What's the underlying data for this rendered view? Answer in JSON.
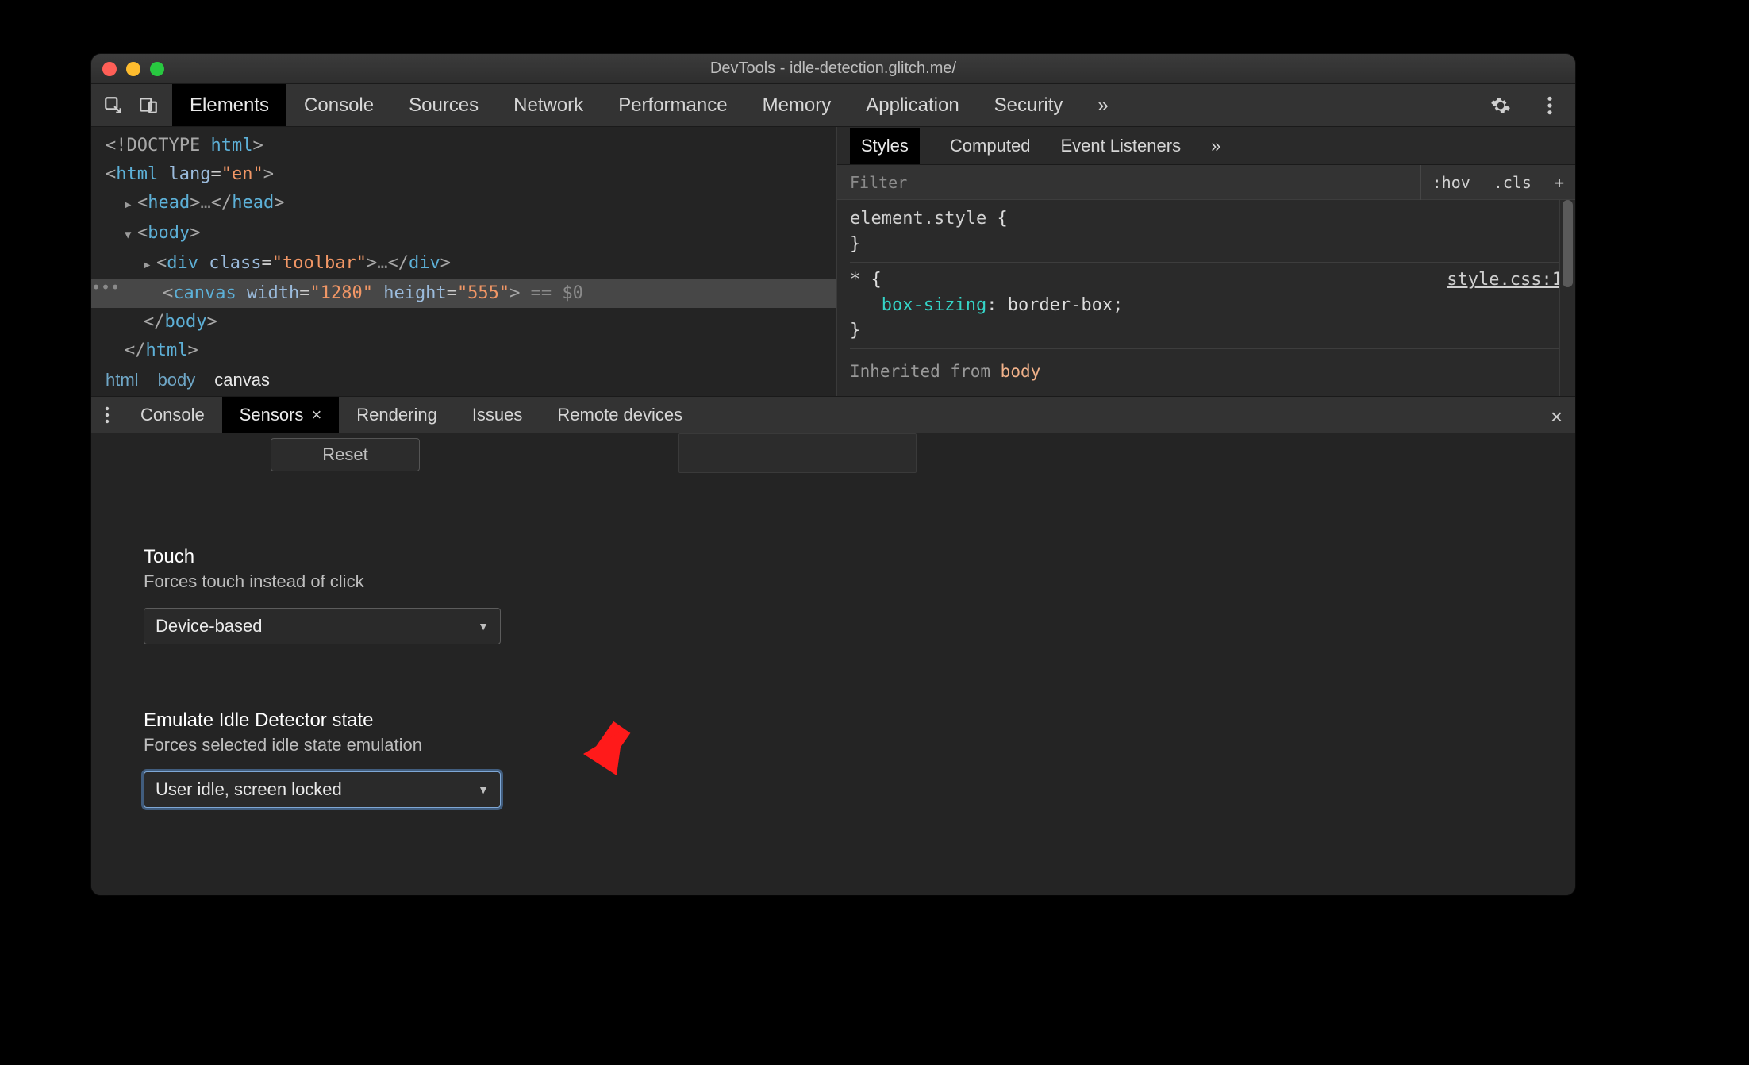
{
  "titlebar": {
    "title": "DevTools - idle-detection.glitch.me/"
  },
  "mainTabs": {
    "items": [
      "Elements",
      "Console",
      "Sources",
      "Network",
      "Performance",
      "Memory",
      "Application",
      "Security"
    ],
    "activeIndex": 0,
    "overflowGlyph": "»"
  },
  "domTree": {
    "lines": [
      {
        "indent": 0,
        "html": "<span class='tk-punc'>&lt;!DOCTYPE <span class='tk-tag'>html</span>&gt;</span>"
      },
      {
        "indent": 0,
        "html": "<span class='tk-punc'>&lt;</span><span class='tk-tag'>html</span> <span class='tk-attr'>lang</span>=<span class='tk-str'>\"en\"</span><span class='tk-punc'>&gt;</span>"
      },
      {
        "indent": 1,
        "html": "<span class='disc'>▶</span><span class='tk-punc'>&lt;</span><span class='tk-tag'>head</span><span class='tk-punc'>&gt;</span><span class='tk-ghost'>…</span><span class='tk-punc'>&lt;/</span><span class='tk-tag'>head</span><span class='tk-punc'>&gt;</span>"
      },
      {
        "indent": 1,
        "html": "<span class='disc'>▼</span><span class='tk-punc'>&lt;</span><span class='tk-tag'>body</span><span class='tk-punc'>&gt;</span>"
      },
      {
        "indent": 2,
        "html": "<span class='disc'>▶</span><span class='tk-punc'>&lt;</span><span class='tk-tag'>div</span> <span class='tk-attr'>class</span>=<span class='tk-str'>\"toolbar\"</span><span class='tk-punc'>&gt;</span><span class='tk-ghost'>…</span><span class='tk-punc'>&lt;/</span><span class='tk-tag'>div</span><span class='tk-punc'>&gt;</span>"
      },
      {
        "indent": 3,
        "sel": true,
        "html": "<span class='tk-punc'>&lt;</span><span class='tk-tag'>canvas</span> <span class='tk-attr'>width</span>=<span class='tk-str'>\"1280\"</span> <span class='tk-attr'>height</span>=<span class='tk-str'>\"555\"</span><span class='tk-punc'>&gt;</span> <span class='tk-ghost'>== $0</span>"
      },
      {
        "indent": 2,
        "html": "<span class='tk-punc'>&lt;/</span><span class='tk-tag'>body</span><span class='tk-punc'>&gt;</span>"
      },
      {
        "indent": 1,
        "html": "<span class='tk-punc'>&lt;/</span><span class='tk-tag'>html</span><span class='tk-punc'>&gt;</span>"
      }
    ],
    "gutterEllipsis": "•••"
  },
  "breadcrumbs": {
    "items": [
      "html",
      "body",
      "canvas"
    ],
    "activeIndex": 2
  },
  "stylesPane": {
    "tabs": [
      "Styles",
      "Computed",
      "Event Listeners"
    ],
    "activeIndex": 0,
    "overflowGlyph": "»",
    "filterPlaceholder": "Filter",
    "actions": {
      "hov": ":hov",
      "cls": ".cls",
      "plus": "+"
    },
    "rules": {
      "elementStyle": {
        "sel": "element.style",
        "open": "{",
        "close": "}"
      },
      "star": {
        "sel": "*",
        "open": "{",
        "decl": {
          "prop": "box-sizing",
          "val": "border-box"
        },
        "close": "}",
        "link": "style.css:1"
      }
    },
    "inherited": {
      "label": "Inherited from",
      "tag": "body"
    }
  },
  "drawer": {
    "tabs": [
      "Console",
      "Sensors",
      "Rendering",
      "Issues",
      "Remote devices"
    ],
    "activeIndex": 1,
    "closeX": "×",
    "reset": "Reset",
    "touch": {
      "title": "Touch",
      "sub": "Forces touch instead of click",
      "value": "Device-based"
    },
    "idle": {
      "title": "Emulate Idle Detector state",
      "sub": "Forces selected idle state emulation",
      "value": "User idle, screen locked"
    }
  },
  "annotation": {
    "arrowColor": "#ff1a1a"
  }
}
